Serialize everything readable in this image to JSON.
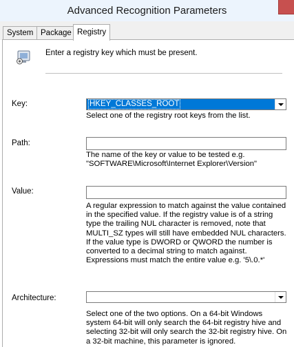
{
  "window": {
    "title": "Advanced Recognition Parameters"
  },
  "tabs": [
    {
      "label": "System",
      "active": false
    },
    {
      "label": "Package",
      "active": false
    },
    {
      "label": "Registry",
      "active": true
    }
  ],
  "intro": {
    "icon": "registry-icon",
    "text": "Enter a registry key which must be present."
  },
  "fields": {
    "key": {
      "label": "Key:",
      "value": "HKEY_CLASSES_ROOT",
      "help": "Select one of the registry root keys from the list."
    },
    "path": {
      "label": "Path:",
      "value": "",
      "help": "The name of the key or value to be tested e.g. \"SOFTWARE\\Microsoft\\Internet Explorer\\Version\""
    },
    "value": {
      "label": "Value:",
      "value": "",
      "help": "A regular expression to match against the value contained in the specified value.  If the registry value is of a string type the trailing NUL character is removed, note that MULTI_SZ types will still have embedded NUL characters.  If the value type is DWORD or QWORD the number is converted to a decimal string to match against. Expressions must match the entire value e.g. '5\\.0.*'"
    },
    "architecture": {
      "label": "Architecture:",
      "value": "",
      "help": "Select one of the two options. On a 64-bit Windows system 64-bit will only search the 64-bit registry hive and selecting 32-bit will only search the 32-bit registry hive. On a 32-bit machine, this parameter is ignored."
    }
  },
  "colors": {
    "selection": "#0078d7",
    "titlebar": "#ecf4fd",
    "close_button": "#c7504f"
  }
}
